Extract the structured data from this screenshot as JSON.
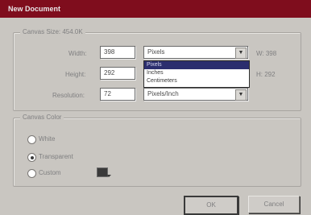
{
  "window": {
    "title": "New Document"
  },
  "canvas_size": {
    "legend": "Canvas Size: 454.0K",
    "width_label": "Width:",
    "width_value": "398",
    "width_unit": "Pixels",
    "width_readout": "W: 398",
    "height_label": "Height:",
    "height_value": "292",
    "height_readout": "H: 292",
    "resolution_label": "Resolution:",
    "resolution_value": "72",
    "resolution_unit": "Pixels/Inch",
    "unit_options": [
      "Pixels",
      "Inches",
      "Centimeters"
    ],
    "selected_option": "Pixels"
  },
  "canvas_color": {
    "legend": "Canvas Color",
    "options": [
      "White",
      "Transparent",
      "Custom"
    ],
    "selected": "Transparent"
  },
  "buttons": {
    "ok": "OK",
    "cancel": "Cancel"
  },
  "colors": {
    "title_bar": "#7f0d1d",
    "dialog_bg": "#c9c6c1",
    "highlight": "#2b2e6e",
    "custom_swatch": "#3a3a3a"
  },
  "icons": {
    "dropdown": "chevron-down-icon",
    "swatch_menu": "triangle-down-icon"
  }
}
